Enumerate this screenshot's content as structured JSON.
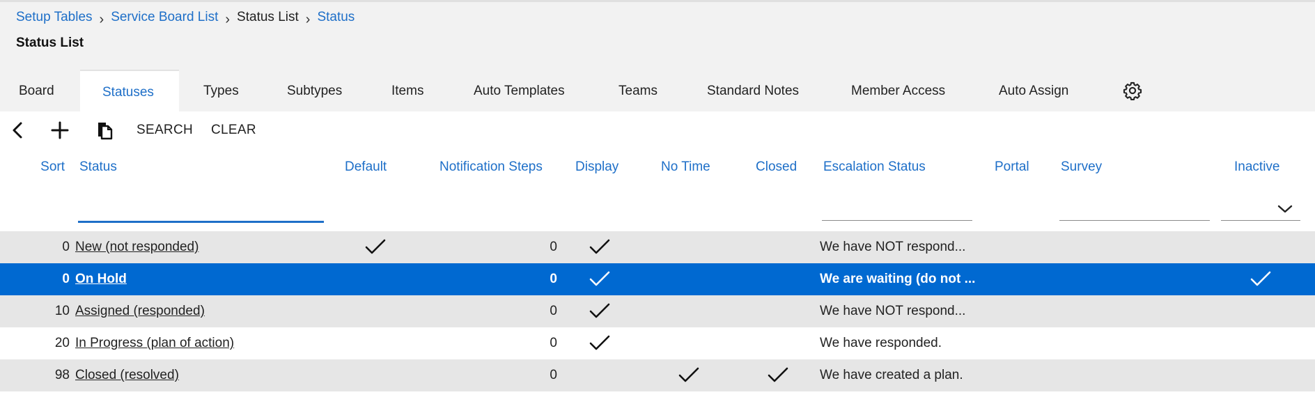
{
  "breadcrumb": [
    {
      "label": "Setup Tables"
    },
    {
      "label": "Service Board List"
    },
    {
      "label": "Status List"
    },
    {
      "label": "Status"
    }
  ],
  "page_title": "Status List",
  "tabs": [
    {
      "label": "Board",
      "active": false
    },
    {
      "label": "Statuses",
      "active": true
    },
    {
      "label": "Types",
      "active": false
    },
    {
      "label": "Subtypes",
      "active": false
    },
    {
      "label": "Items",
      "active": false
    },
    {
      "label": "Auto Templates",
      "active": false
    },
    {
      "label": "Teams",
      "active": false
    },
    {
      "label": "Standard Notes",
      "active": false
    },
    {
      "label": "Member Access",
      "active": false
    },
    {
      "label": "Auto Assign",
      "active": false
    }
  ],
  "toolbar": {
    "search_label": "SEARCH",
    "clear_label": "CLEAR",
    "icons": [
      "back-chevron-icon",
      "add-plus-icon",
      "copy-icon"
    ]
  },
  "columns": {
    "sort": "Sort",
    "status": "Status",
    "default": "Default",
    "notification_steps": "Notification Steps",
    "display": "Display",
    "no_time": "No Time",
    "closed": "Closed",
    "escalation_status": "Escalation Status",
    "portal": "Portal",
    "survey": "Survey",
    "inactive": "Inactive"
  },
  "filters": {
    "status_value": "",
    "escalation_value": "",
    "survey_value": "",
    "inactive_value": ""
  },
  "rows": [
    {
      "sort": "0",
      "status": "New (not responded)",
      "default": true,
      "notification_steps": "0",
      "display": true,
      "no_time": false,
      "closed": false,
      "escalation": "We have NOT respond...",
      "inactive": false,
      "selected": false
    },
    {
      "sort": "0",
      "status": "On Hold",
      "default": false,
      "notification_steps": "0",
      "display": true,
      "no_time": false,
      "closed": false,
      "escalation": "We are waiting (do not ...",
      "inactive": true,
      "selected": true
    },
    {
      "sort": "10",
      "status": "Assigned (responded)",
      "default": false,
      "notification_steps": "0",
      "display": true,
      "no_time": false,
      "closed": false,
      "escalation": "We have NOT respond...",
      "inactive": false,
      "selected": false
    },
    {
      "sort": "20",
      "status": "In Progress (plan of action)",
      "default": false,
      "notification_steps": "0",
      "display": true,
      "no_time": false,
      "closed": false,
      "escalation": "We have responded.",
      "inactive": false,
      "selected": false
    },
    {
      "sort": "98",
      "status": "Closed (resolved)",
      "default": false,
      "notification_steps": "0",
      "display": false,
      "no_time": true,
      "closed": true,
      "escalation": "We have created a plan.",
      "inactive": false,
      "selected": false
    }
  ],
  "colors": {
    "accent": "#1e6fc8",
    "selected_row": "#0069d1",
    "alt_row": "#e6e6e6",
    "top_bar": "#f2f2f2"
  }
}
